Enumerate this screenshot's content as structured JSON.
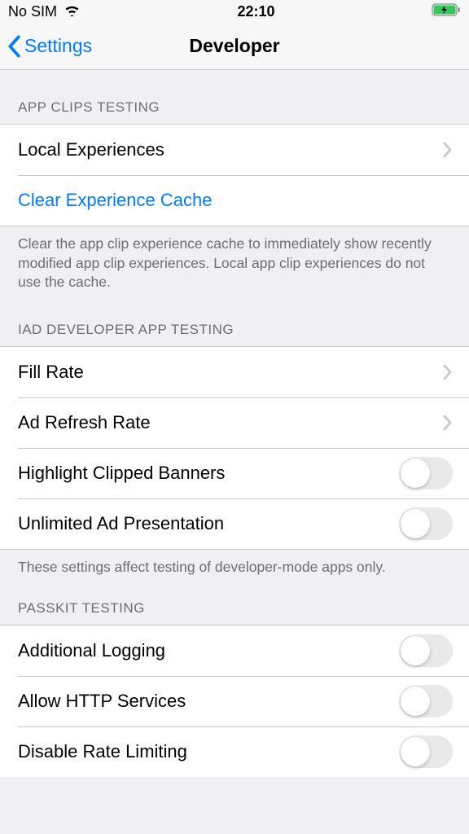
{
  "status": {
    "carrier": "No SIM",
    "time": "22:10"
  },
  "nav": {
    "back": "Settings",
    "title": "Developer"
  },
  "sections": {
    "appClips": {
      "header": "APP CLIPS TESTING",
      "localExperiences": "Local Experiences",
      "clearCache": "Clear Experience Cache",
      "footer": "Clear the app clip experience cache to immediately show recently modified app clip experiences. Local app clip experiences do not use the cache."
    },
    "iad": {
      "header": "IAD DEVELOPER APP TESTING",
      "fillRate": "Fill Rate",
      "adRefreshRate": "Ad Refresh Rate",
      "highlightClipped": "Highlight Clipped Banners",
      "unlimitedAd": "Unlimited Ad Presentation",
      "footer": "These settings affect testing of developer-mode apps only."
    },
    "passkit": {
      "header": "PASSKIT TESTING",
      "additionalLogging": "Additional Logging",
      "allowHttp": "Allow HTTP Services",
      "disableRateLimiting": "Disable Rate Limiting"
    }
  }
}
